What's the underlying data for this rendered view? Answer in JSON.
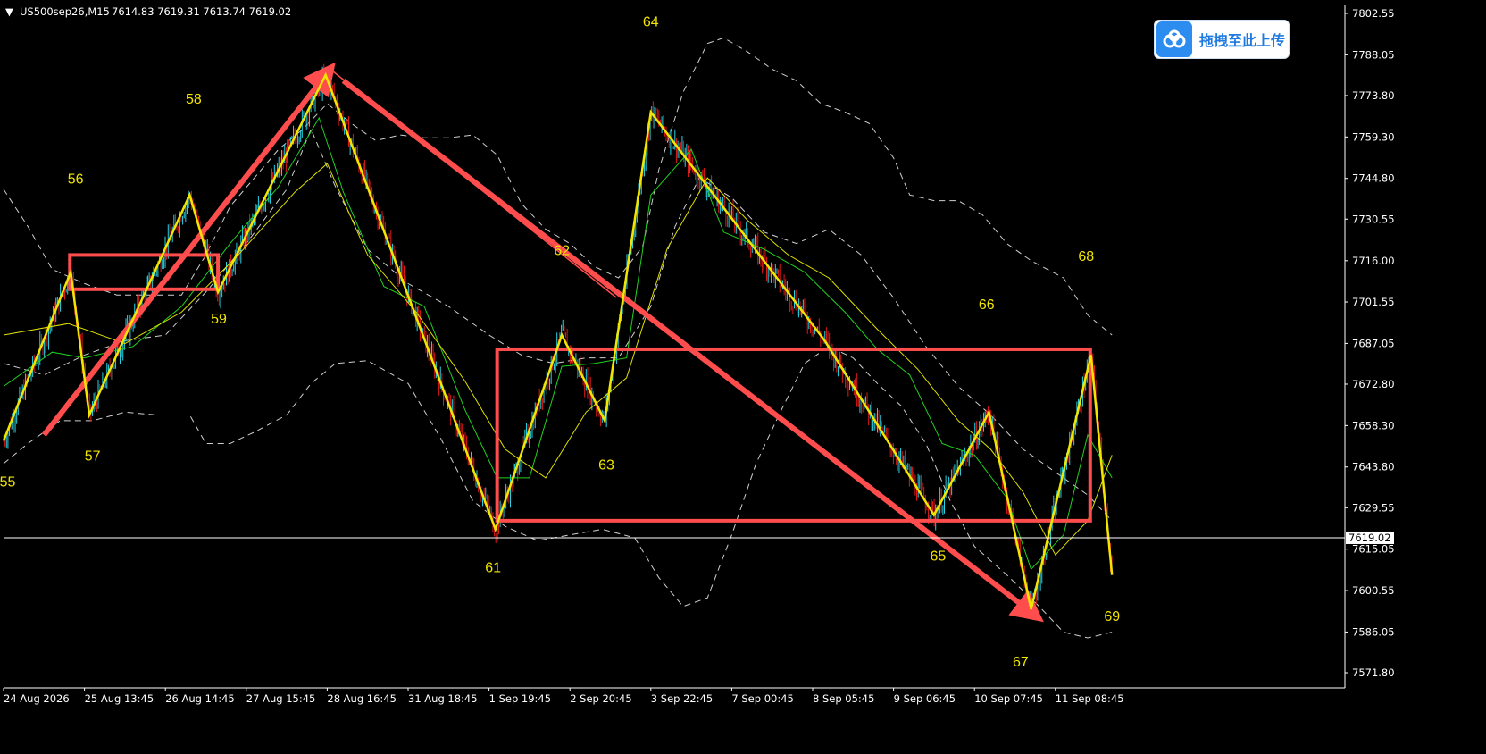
{
  "header": {
    "arrow": "▼",
    "symbol": "US500sep26,M15",
    "ohlc": "7614.83 7619.31 7613.74 7619.02"
  },
  "upload_button": {
    "label": "拖拽至此上传",
    "icon": "cloud-upload-icon",
    "icon_color": "#2d8cf0"
  },
  "colors": {
    "background": "#000000",
    "bull_candle": "#29d3e6",
    "bear_candle": "#e01919",
    "zigzag": "#f2e600",
    "annotation": "#ff4d4d",
    "bollinger": "#cfcfcf",
    "ma_fast": "#1fd21f",
    "ma_slow": "#e0e000",
    "wave_label": "#f2e600",
    "axis_text": "#ffffff"
  },
  "chart_data": {
    "type": "candlestick",
    "symbol": "US500sep26",
    "timeframe": "M15",
    "current_price": "7619.02",
    "y_ticks": [
      "7802.55",
      "7788.05",
      "7773.80",
      "7759.30",
      "7744.80",
      "7730.55",
      "7716.00",
      "7701.55",
      "7687.05",
      "7672.80",
      "7658.30",
      "7643.80",
      "7629.55",
      "7615.05",
      "7600.55",
      "7586.05",
      "7571.80"
    ],
    "ylim": [
      7566,
      7805
    ],
    "x_ticks": [
      "24 Aug 2026",
      "25 Aug 13:45",
      "26 Aug 14:45",
      "27 Aug 15:45",
      "28 Aug 16:45",
      "31 Aug 18:45",
      "1 Sep 19:45",
      "2 Sep 20:45",
      "3 Sep 22:45",
      "7 Sep 00:45",
      "8 Sep 05:45",
      "9 Sep 06:45",
      "10 Sep 07:45",
      "11 Sep 08:45"
    ],
    "zigzag": [
      {
        "x": 0.0,
        "y": 7653
      },
      {
        "x": 8.3,
        "y": 7712
      },
      {
        "x": 10.6,
        "y": 7662
      },
      {
        "x": 23.0,
        "y": 7739
      },
      {
        "x": 26.5,
        "y": 7705
      },
      {
        "x": 39.8,
        "y": 7781
      },
      {
        "x": 60.8,
        "y": 7622
      },
      {
        "x": 69.0,
        "y": 7690
      },
      {
        "x": 74.3,
        "y": 7660
      },
      {
        "x": 80.0,
        "y": 7768
      },
      {
        "x": 101.5,
        "y": 7688
      },
      {
        "x": 115.0,
        "y": 7627
      },
      {
        "x": 121.8,
        "y": 7663
      },
      {
        "x": 127.0,
        "y": 7594
      },
      {
        "x": 134.4,
        "y": 7683
      },
      {
        "x": 137.0,
        "y": 7606
      }
    ],
    "wave_labels": [
      {
        "text": "55",
        "x": 0.5,
        "y": 7637
      },
      {
        "text": "56",
        "x": 8.9,
        "y": 7743
      },
      {
        "text": "57",
        "x": 11.0,
        "y": 7646
      },
      {
        "text": "58",
        "x": 23.5,
        "y": 7771
      },
      {
        "text": "59",
        "x": 26.6,
        "y": 7694
      },
      {
        "text": "61",
        "x": 60.5,
        "y": 7607
      },
      {
        "text": "62",
        "x": 69.0,
        "y": 7718
      },
      {
        "text": "63",
        "x": 74.5,
        "y": 7643
      },
      {
        "text": "64",
        "x": 80.0,
        "y": 7798
      },
      {
        "text": "65",
        "x": 115.5,
        "y": 7611
      },
      {
        "text": "66",
        "x": 121.5,
        "y": 7699
      },
      {
        "text": "67",
        "x": 125.7,
        "y": 7574
      },
      {
        "text": "68",
        "x": 133.8,
        "y": 7716
      },
      {
        "text": "69",
        "x": 137.0,
        "y": 7590
      }
    ],
    "annotation_rects": [
      {
        "x0": 8.2,
        "x1": 26.5,
        "y0": 7706,
        "y1": 7718
      },
      {
        "x0": 61.0,
        "x1": 134.3,
        "y0": 7625,
        "y1": 7685
      }
    ],
    "annotation_arrows": [
      {
        "x0": 5.0,
        "y0": 7655,
        "x1": 39.8,
        "y1": 7781
      },
      {
        "x0": 42.0,
        "y0": 7779,
        "x1": 127.0,
        "y1": 7593
      }
    ],
    "bollinger_upper": [
      [
        0,
        7741
      ],
      [
        3,
        7728
      ],
      [
        6,
        7713
      ],
      [
        10,
        7708
      ],
      [
        14,
        7704
      ],
      [
        18,
        7704
      ],
      [
        22,
        7704
      ],
      [
        25,
        7718
      ],
      [
        28,
        7735
      ],
      [
        31,
        7745
      ],
      [
        34,
        7755
      ],
      [
        37,
        7762
      ],
      [
        40,
        7771
      ],
      [
        43,
        7764
      ],
      [
        46,
        7758
      ],
      [
        49,
        7760
      ],
      [
        52,
        7759
      ],
      [
        55,
        7759
      ],
      [
        58,
        7760
      ],
      [
        61,
        7753
      ],
      [
        64,
        7736
      ],
      [
        67,
        7727
      ],
      [
        70,
        7722
      ],
      [
        73,
        7714
      ],
      [
        76,
        7710
      ],
      [
        79,
        7721
      ],
      [
        81,
        7748
      ],
      [
        84,
        7775
      ],
      [
        87,
        7792
      ],
      [
        89,
        7794
      ],
      [
        92,
        7789
      ],
      [
        95,
        7783
      ],
      [
        98,
        7779
      ],
      [
        101,
        7771
      ],
      [
        104,
        7768
      ],
      [
        107,
        7764
      ],
      [
        110,
        7752
      ],
      [
        112,
        7739
      ],
      [
        115,
        7737
      ],
      [
        118,
        7737
      ],
      [
        121,
        7732
      ],
      [
        124,
        7722
      ],
      [
        127,
        7716
      ],
      [
        131,
        7710
      ],
      [
        134,
        7697
      ],
      [
        137,
        7690
      ]
    ],
    "bollinger_middle": [
      [
        0,
        7680
      ],
      [
        5,
        7676
      ],
      [
        10,
        7683
      ],
      [
        15,
        7688
      ],
      [
        20,
        7690
      ],
      [
        25,
        7705
      ],
      [
        30,
        7722
      ],
      [
        35,
        7741
      ],
      [
        38,
        7762
      ],
      [
        41,
        7742
      ],
      [
        45,
        7720
      ],
      [
        50,
        7708
      ],
      [
        55,
        7700
      ],
      [
        60,
        7690
      ],
      [
        64,
        7683
      ],
      [
        68,
        7680
      ],
      [
        72,
        7682
      ],
      [
        76,
        7682
      ],
      [
        80,
        7700
      ],
      [
        83,
        7728
      ],
      [
        86,
        7745
      ],
      [
        90,
        7738
      ],
      [
        94,
        7726
      ],
      [
        98,
        7722
      ],
      [
        102,
        7727
      ],
      [
        106,
        7718
      ],
      [
        110,
        7703
      ],
      [
        114,
        7686
      ],
      [
        118,
        7672
      ],
      [
        122,
        7662
      ],
      [
        126,
        7650
      ],
      [
        130,
        7642
      ],
      [
        134,
        7634
      ],
      [
        137,
        7625
      ]
    ],
    "bollinger_lower": [
      [
        0,
        7645
      ],
      [
        3,
        7652
      ],
      [
        7,
        7660
      ],
      [
        11,
        7660
      ],
      [
        15,
        7663
      ],
      [
        19,
        7662
      ],
      [
        23,
        7662
      ],
      [
        25,
        7652
      ],
      [
        28,
        7652
      ],
      [
        31,
        7656
      ],
      [
        35,
        7662
      ],
      [
        38,
        7673
      ],
      [
        41,
        7680
      ],
      [
        45,
        7681
      ],
      [
        50,
        7673
      ],
      [
        54,
        7654
      ],
      [
        58,
        7632
      ],
      [
        62,
        7623
      ],
      [
        66,
        7618
      ],
      [
        70,
        7620
      ],
      [
        74,
        7622
      ],
      [
        78,
        7619
      ],
      [
        81,
        7605
      ],
      [
        84,
        7595
      ],
      [
        87,
        7598
      ],
      [
        90,
        7620
      ],
      [
        93,
        7645
      ],
      [
        96,
        7663
      ],
      [
        99,
        7680
      ],
      [
        102,
        7686
      ],
      [
        105,
        7682
      ],
      [
        108,
        7673
      ],
      [
        111,
        7665
      ],
      [
        114,
        7652
      ],
      [
        117,
        7632
      ],
      [
        120,
        7616
      ],
      [
        124,
        7606
      ],
      [
        128,
        7595
      ],
      [
        131,
        7586
      ],
      [
        134,
        7584
      ],
      [
        137,
        7586
      ]
    ],
    "ma_fast": [
      [
        0,
        7672
      ],
      [
        6,
        7684
      ],
      [
        10,
        7682
      ],
      [
        16,
        7686
      ],
      [
        22,
        7700
      ],
      [
        28,
        7722
      ],
      [
        34,
        7742
      ],
      [
        39,
        7766
      ],
      [
        42,
        7740
      ],
      [
        47,
        7707
      ],
      [
        52,
        7700
      ],
      [
        57,
        7664
      ],
      [
        61,
        7640
      ],
      [
        65,
        7640
      ],
      [
        69,
        7679
      ],
      [
        73,
        7680
      ],
      [
        77,
        7682
      ],
      [
        80,
        7739
      ],
      [
        85,
        7755
      ],
      [
        89,
        7726
      ],
      [
        94,
        7720
      ],
      [
        99,
        7712
      ],
      [
        104,
        7698
      ],
      [
        108,
        7685
      ],
      [
        112,
        7676
      ],
      [
        116,
        7652
      ],
      [
        120,
        7648
      ],
      [
        124,
        7633
      ],
      [
        127,
        7608
      ],
      [
        131,
        7620
      ],
      [
        134,
        7655
      ],
      [
        137,
        7640
      ]
    ],
    "ma_slow": [
      [
        0,
        7690
      ],
      [
        8,
        7694
      ],
      [
        15,
        7687
      ],
      [
        22,
        7698
      ],
      [
        29,
        7718
      ],
      [
        36,
        7740
      ],
      [
        40,
        7750
      ],
      [
        45,
        7718
      ],
      [
        51,
        7698
      ],
      [
        57,
        7674
      ],
      [
        62,
        7650
      ],
      [
        67,
        7640
      ],
      [
        72,
        7663
      ],
      [
        77,
        7675
      ],
      [
        82,
        7720
      ],
      [
        87,
        7745
      ],
      [
        92,
        7730
      ],
      [
        97,
        7718
      ],
      [
        102,
        7710
      ],
      [
        108,
        7692
      ],
      [
        113,
        7678
      ],
      [
        118,
        7660
      ],
      [
        122,
        7650
      ],
      [
        126,
        7635
      ],
      [
        130,
        7613
      ],
      [
        134,
        7625
      ],
      [
        137,
        7648
      ]
    ]
  }
}
